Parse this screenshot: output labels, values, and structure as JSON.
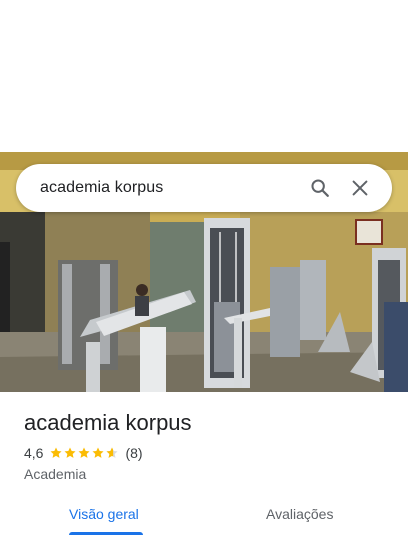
{
  "search": {
    "query": "academia korpus"
  },
  "place": {
    "name": "academia korpus",
    "rating": "4,6",
    "rating_stars": 4.6,
    "review_count": "(8)",
    "category": "Academia"
  },
  "tabs": [
    {
      "label": "Visão geral",
      "selected": true
    },
    {
      "label": "Avaliações",
      "selected": false
    }
  ],
  "colors": {
    "accent": "#1a73e8",
    "star": "#fbbc04"
  },
  "icons": {
    "search": "search-icon",
    "clear": "close-icon"
  }
}
